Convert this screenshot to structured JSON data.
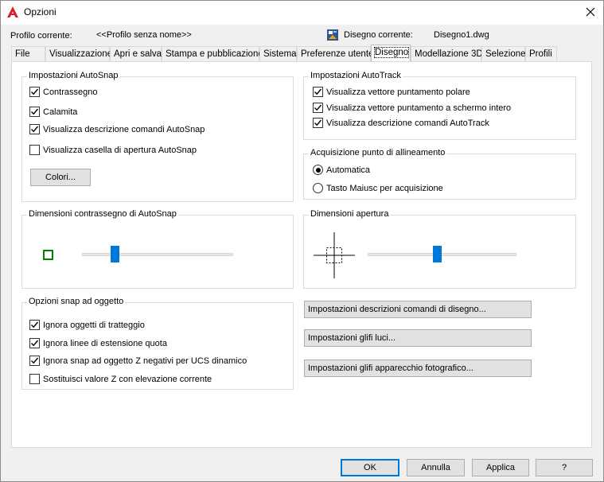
{
  "window": {
    "title": "Opzioni",
    "app_icon": "autocad-a-icon",
    "close_icon": "close-icon"
  },
  "header": {
    "profile_label": "Profilo corrente:",
    "profile_value": "<<Profilo senza nome>>",
    "drawing_label": "Disegno corrente:",
    "drawing_value": "Disegno1.dwg",
    "drawing_icon": "drawing-file-icon"
  },
  "tabs": [
    {
      "label": "File"
    },
    {
      "label": "Visualizzazione"
    },
    {
      "label": "Apri e salva"
    },
    {
      "label": "Stampa e pubblicazione"
    },
    {
      "label": "Sistema"
    },
    {
      "label": "Preferenze utente"
    },
    {
      "label": "Disegno",
      "active": true
    },
    {
      "label": "Modellazione 3D"
    },
    {
      "label": "Selezione"
    },
    {
      "label": "Profili"
    }
  ],
  "autosnap": {
    "title": "Impostazioni AutoSnap",
    "marker": {
      "label": "Contrassegno",
      "checked": true
    },
    "magnet": {
      "label": "Calamita",
      "checked": true
    },
    "tooltips": {
      "label": "Visualizza descrizione comandi AutoSnap",
      "checked": true
    },
    "aperture_box": {
      "label": "Visualizza casella di apertura AutoSnap",
      "checked": false
    },
    "colors_button": "Colori..."
  },
  "autotrack": {
    "title": "Impostazioni AutoTrack",
    "polar": {
      "label": "Visualizza vettore puntamento polare",
      "checked": true
    },
    "fullscreen": {
      "label": "Visualizza vettore puntamento a schermo intero",
      "checked": true
    },
    "tooltips": {
      "label": "Visualizza descrizione comandi AutoTrack",
      "checked": true
    }
  },
  "alignment": {
    "title": "Acquisizione punto di allineamento",
    "automatic": {
      "label": "Automatica",
      "selected": true
    },
    "shift": {
      "label": "Tasto Maiusc per acquisizione",
      "selected": false
    }
  },
  "marker_size": {
    "title": "Dimensioni contrassegno di AutoSnap",
    "slider_value": 0.22,
    "marker_color": "#008000"
  },
  "aperture_size": {
    "title": "Dimensioni apertura",
    "slider_value": 0.47
  },
  "object_snap": {
    "title": "Opzioni snap ad oggetto",
    "hatch": {
      "label": "Ignora oggetti di tratteggio",
      "checked": true
    },
    "dimext": {
      "label": "Ignora linee di estensione quota",
      "checked": true
    },
    "negz": {
      "label": "Ignora snap ad oggetto Z negativi per UCS dinamico",
      "checked": true
    },
    "replacez": {
      "label": "Sostituisci valore Z con elevazione corrente",
      "checked": false
    }
  },
  "side_buttons": {
    "tooltip_settings": "Impostazioni descrizioni comandi di disegno...",
    "light_glyph": "Impostazioni glifi luci...",
    "camera_glyph": "Impostazioni glifi apparecchio fotografico..."
  },
  "footer": {
    "ok": "OK",
    "cancel": "Annulla",
    "apply": "Applica",
    "help": "?"
  },
  "colors": {
    "accent": "#0078d7",
    "marker_green": "#008000",
    "app_red": "#d9202a"
  }
}
